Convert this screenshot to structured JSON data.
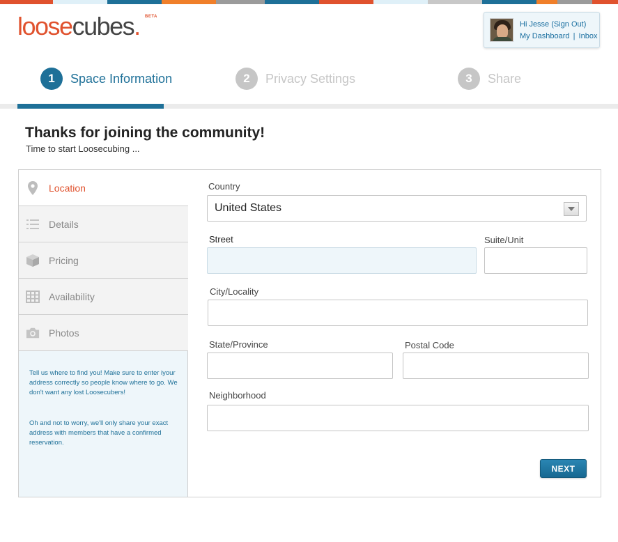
{
  "colors": {
    "accent": "#1e7098",
    "brand_orange": "#e0522e",
    "color_bar": [
      "#e0522e",
      "#dff0f8",
      "#1e7098",
      "#f07f2a",
      "#9b9b9b",
      "#1e7098",
      "#e0522e",
      "#dff0f8",
      "#c8c8c8",
      "#1e7098",
      "#f07f2a",
      "#9b9b9b",
      "#e0522e"
    ]
  },
  "brand": {
    "part1": "loose",
    "part2": "cubes",
    "dot": ".",
    "beta": "BETA"
  },
  "user": {
    "greeting": "Hi Jesse",
    "sign_out": "(Sign Out)",
    "dashboard": "My Dashboard",
    "separator": "|",
    "inbox": "Inbox"
  },
  "steps": [
    {
      "number": "1",
      "label": "Space Information",
      "state": "active"
    },
    {
      "number": "2",
      "label": "Privacy Settings",
      "state": "inactive"
    },
    {
      "number": "3",
      "label": "Share",
      "state": "inactive"
    }
  ],
  "page": {
    "heading": "Thanks for joining the community!",
    "subheading": "Time to start Loosecubing ..."
  },
  "sidebar": {
    "items": [
      {
        "label": "Location",
        "icon": "map-pin-icon",
        "active": true
      },
      {
        "label": "Details",
        "icon": "list-icon",
        "active": false
      },
      {
        "label": "Pricing",
        "icon": "cube-icon",
        "active": false
      },
      {
        "label": "Availability",
        "icon": "calendar-grid-icon",
        "active": false
      },
      {
        "label": "Photos",
        "icon": "camera-icon",
        "active": false
      }
    ],
    "help1": "Tell us where to find you!  Make sure to enter iyour address correctly so people know where to go. We don't want any lost Loosecubers!",
    "help2": "Oh and not to worry, we'll only share your exact address with members that have a confirmed reservation."
  },
  "form": {
    "country_label": "Country",
    "country_value": "United States",
    "street_label": "Street",
    "street_value": "",
    "suite_label": "Suite/Unit",
    "suite_value": "",
    "city_label": "City/Locality",
    "city_value": "",
    "state_label": "State/Province",
    "state_value": "",
    "postal_label": "Postal Code",
    "postal_value": "",
    "neighborhood_label": "Neighborhood",
    "neighborhood_value": "",
    "next_label": "NEXT"
  }
}
